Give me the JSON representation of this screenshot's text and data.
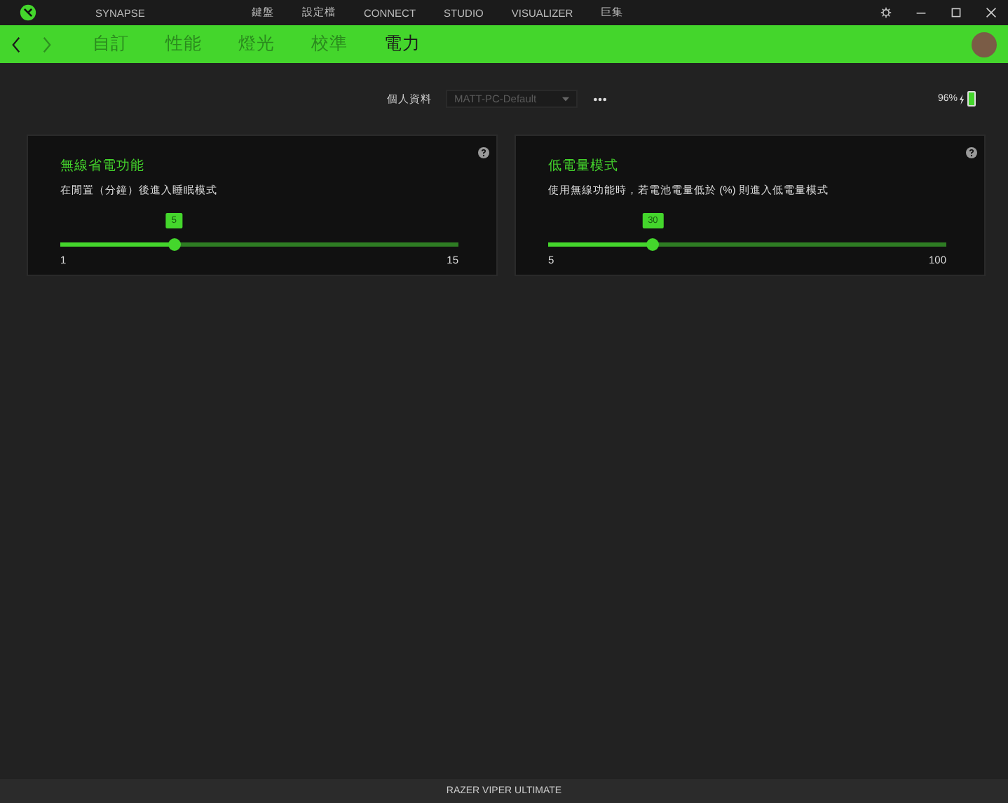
{
  "top_tabs": [
    {
      "label": "SYNAPSE"
    },
    {
      "label": "鍵盤"
    },
    {
      "label": "設定檔"
    },
    {
      "label": "CONNECT"
    },
    {
      "label": "STUDIO"
    },
    {
      "label": "VISUALIZER"
    },
    {
      "label": "巨集"
    }
  ],
  "sub_tabs": [
    {
      "label": "自訂",
      "selected": false
    },
    {
      "label": "性能",
      "selected": false
    },
    {
      "label": "燈光",
      "selected": false
    },
    {
      "label": "校準",
      "selected": false
    },
    {
      "label": "電力",
      "selected": true
    }
  ],
  "profile": {
    "label": "個人資料",
    "value": "MATT-PC-Default"
  },
  "battery": {
    "reading": "96%",
    "level": 0.96
  },
  "cards": [
    {
      "title": "無線省電功能",
      "description": "在閒置（分鐘）後進入睡眠模式",
      "value": "5",
      "min": "1",
      "max": "15",
      "level": 0.286
    },
    {
      "title": "低電量模式",
      "description": "使用無線功能時，若電池電量低於 (%) 則進入低電量模式",
      "value": "30",
      "min": "5",
      "max": "100",
      "level": 0.263
    }
  ],
  "status_bar": "RAZER VIPER ULTIMATE"
}
